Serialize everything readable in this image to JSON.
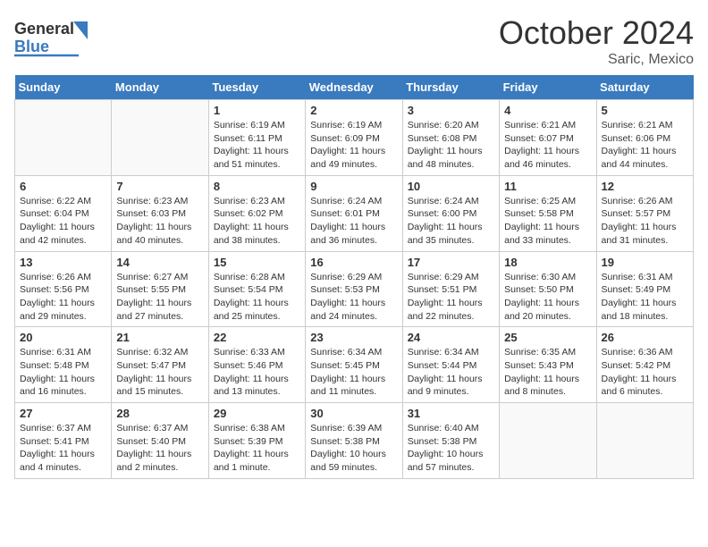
{
  "header": {
    "logo_general": "General",
    "logo_blue": "Blue",
    "month": "October 2024",
    "location": "Saric, Mexico"
  },
  "days_of_week": [
    "Sunday",
    "Monday",
    "Tuesday",
    "Wednesday",
    "Thursday",
    "Friday",
    "Saturday"
  ],
  "weeks": [
    [
      {
        "day": "",
        "text": ""
      },
      {
        "day": "",
        "text": ""
      },
      {
        "day": "1",
        "text": "Sunrise: 6:19 AM\nSunset: 6:11 PM\nDaylight: 11 hours and 51 minutes."
      },
      {
        "day": "2",
        "text": "Sunrise: 6:19 AM\nSunset: 6:09 PM\nDaylight: 11 hours and 49 minutes."
      },
      {
        "day": "3",
        "text": "Sunrise: 6:20 AM\nSunset: 6:08 PM\nDaylight: 11 hours and 48 minutes."
      },
      {
        "day": "4",
        "text": "Sunrise: 6:21 AM\nSunset: 6:07 PM\nDaylight: 11 hours and 46 minutes."
      },
      {
        "day": "5",
        "text": "Sunrise: 6:21 AM\nSunset: 6:06 PM\nDaylight: 11 hours and 44 minutes."
      }
    ],
    [
      {
        "day": "6",
        "text": "Sunrise: 6:22 AM\nSunset: 6:04 PM\nDaylight: 11 hours and 42 minutes."
      },
      {
        "day": "7",
        "text": "Sunrise: 6:23 AM\nSunset: 6:03 PM\nDaylight: 11 hours and 40 minutes."
      },
      {
        "day": "8",
        "text": "Sunrise: 6:23 AM\nSunset: 6:02 PM\nDaylight: 11 hours and 38 minutes."
      },
      {
        "day": "9",
        "text": "Sunrise: 6:24 AM\nSunset: 6:01 PM\nDaylight: 11 hours and 36 minutes."
      },
      {
        "day": "10",
        "text": "Sunrise: 6:24 AM\nSunset: 6:00 PM\nDaylight: 11 hours and 35 minutes."
      },
      {
        "day": "11",
        "text": "Sunrise: 6:25 AM\nSunset: 5:58 PM\nDaylight: 11 hours and 33 minutes."
      },
      {
        "day": "12",
        "text": "Sunrise: 6:26 AM\nSunset: 5:57 PM\nDaylight: 11 hours and 31 minutes."
      }
    ],
    [
      {
        "day": "13",
        "text": "Sunrise: 6:26 AM\nSunset: 5:56 PM\nDaylight: 11 hours and 29 minutes."
      },
      {
        "day": "14",
        "text": "Sunrise: 6:27 AM\nSunset: 5:55 PM\nDaylight: 11 hours and 27 minutes."
      },
      {
        "day": "15",
        "text": "Sunrise: 6:28 AM\nSunset: 5:54 PM\nDaylight: 11 hours and 25 minutes."
      },
      {
        "day": "16",
        "text": "Sunrise: 6:29 AM\nSunset: 5:53 PM\nDaylight: 11 hours and 24 minutes."
      },
      {
        "day": "17",
        "text": "Sunrise: 6:29 AM\nSunset: 5:51 PM\nDaylight: 11 hours and 22 minutes."
      },
      {
        "day": "18",
        "text": "Sunrise: 6:30 AM\nSunset: 5:50 PM\nDaylight: 11 hours and 20 minutes."
      },
      {
        "day": "19",
        "text": "Sunrise: 6:31 AM\nSunset: 5:49 PM\nDaylight: 11 hours and 18 minutes."
      }
    ],
    [
      {
        "day": "20",
        "text": "Sunrise: 6:31 AM\nSunset: 5:48 PM\nDaylight: 11 hours and 16 minutes."
      },
      {
        "day": "21",
        "text": "Sunrise: 6:32 AM\nSunset: 5:47 PM\nDaylight: 11 hours and 15 minutes."
      },
      {
        "day": "22",
        "text": "Sunrise: 6:33 AM\nSunset: 5:46 PM\nDaylight: 11 hours and 13 minutes."
      },
      {
        "day": "23",
        "text": "Sunrise: 6:34 AM\nSunset: 5:45 PM\nDaylight: 11 hours and 11 minutes."
      },
      {
        "day": "24",
        "text": "Sunrise: 6:34 AM\nSunset: 5:44 PM\nDaylight: 11 hours and 9 minutes."
      },
      {
        "day": "25",
        "text": "Sunrise: 6:35 AM\nSunset: 5:43 PM\nDaylight: 11 hours and 8 minutes."
      },
      {
        "day": "26",
        "text": "Sunrise: 6:36 AM\nSunset: 5:42 PM\nDaylight: 11 hours and 6 minutes."
      }
    ],
    [
      {
        "day": "27",
        "text": "Sunrise: 6:37 AM\nSunset: 5:41 PM\nDaylight: 11 hours and 4 minutes."
      },
      {
        "day": "28",
        "text": "Sunrise: 6:37 AM\nSunset: 5:40 PM\nDaylight: 11 hours and 2 minutes."
      },
      {
        "day": "29",
        "text": "Sunrise: 6:38 AM\nSunset: 5:39 PM\nDaylight: 11 hours and 1 minute."
      },
      {
        "day": "30",
        "text": "Sunrise: 6:39 AM\nSunset: 5:38 PM\nDaylight: 10 hours and 59 minutes."
      },
      {
        "day": "31",
        "text": "Sunrise: 6:40 AM\nSunset: 5:38 PM\nDaylight: 10 hours and 57 minutes."
      },
      {
        "day": "",
        "text": ""
      },
      {
        "day": "",
        "text": ""
      }
    ]
  ]
}
